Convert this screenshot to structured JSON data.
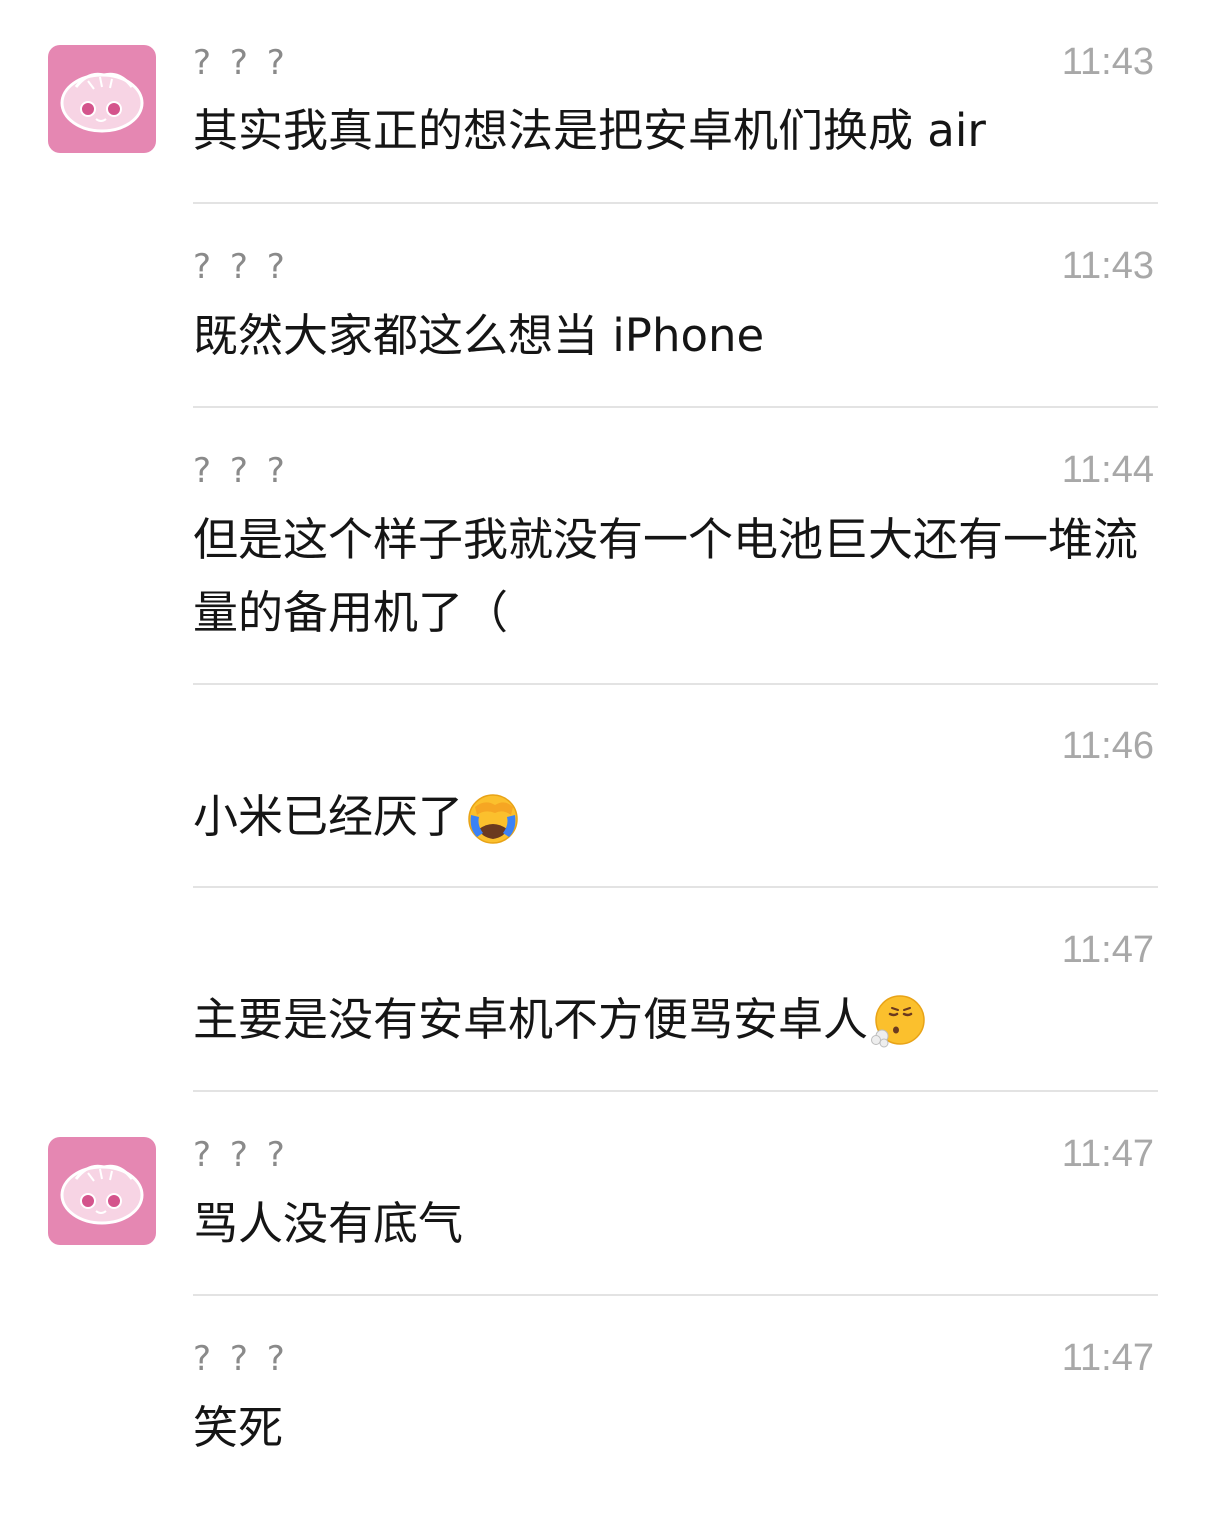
{
  "messages": [
    {
      "sender": "? ? ?",
      "time": "11:43",
      "text": "其实我真正的想法是把安卓机们换成 air",
      "show_avatar": true,
      "emoji": ""
    },
    {
      "sender": "? ? ?",
      "time": "11:43",
      "text": "既然大家都这么想当 iPhone",
      "show_avatar": false,
      "emoji": ""
    },
    {
      "sender": "? ? ?",
      "time": "11:44",
      "text": "但是这个样子我就没有一个电池巨大还有一堆流量的备用机了（",
      "show_avatar": false,
      "emoji": ""
    },
    {
      "sender": "",
      "time": "11:46",
      "text": "小米已经厌了",
      "show_avatar": false,
      "emoji": "face-with-hand-over-face-crying-emoji"
    },
    {
      "sender": "",
      "time": "11:47",
      "text": "主要是没有安卓机不方便骂安卓人",
      "show_avatar": false,
      "emoji": "face-exhaling-emoji"
    },
    {
      "sender": "? ? ?",
      "time": "11:47",
      "text": "骂人没有底气",
      "show_avatar": true,
      "emoji": ""
    },
    {
      "sender": "? ? ?",
      "time": "11:47",
      "text": "笑死",
      "show_avatar": false,
      "emoji": ""
    }
  ],
  "colors": {
    "avatar_bg": "#e587b2",
    "divider": "#e3e3e3",
    "meta_text": "#a8a8a8",
    "body_text": "#151515"
  },
  "avatar_icon": "pink-cartoon-blob-avatar-icon"
}
